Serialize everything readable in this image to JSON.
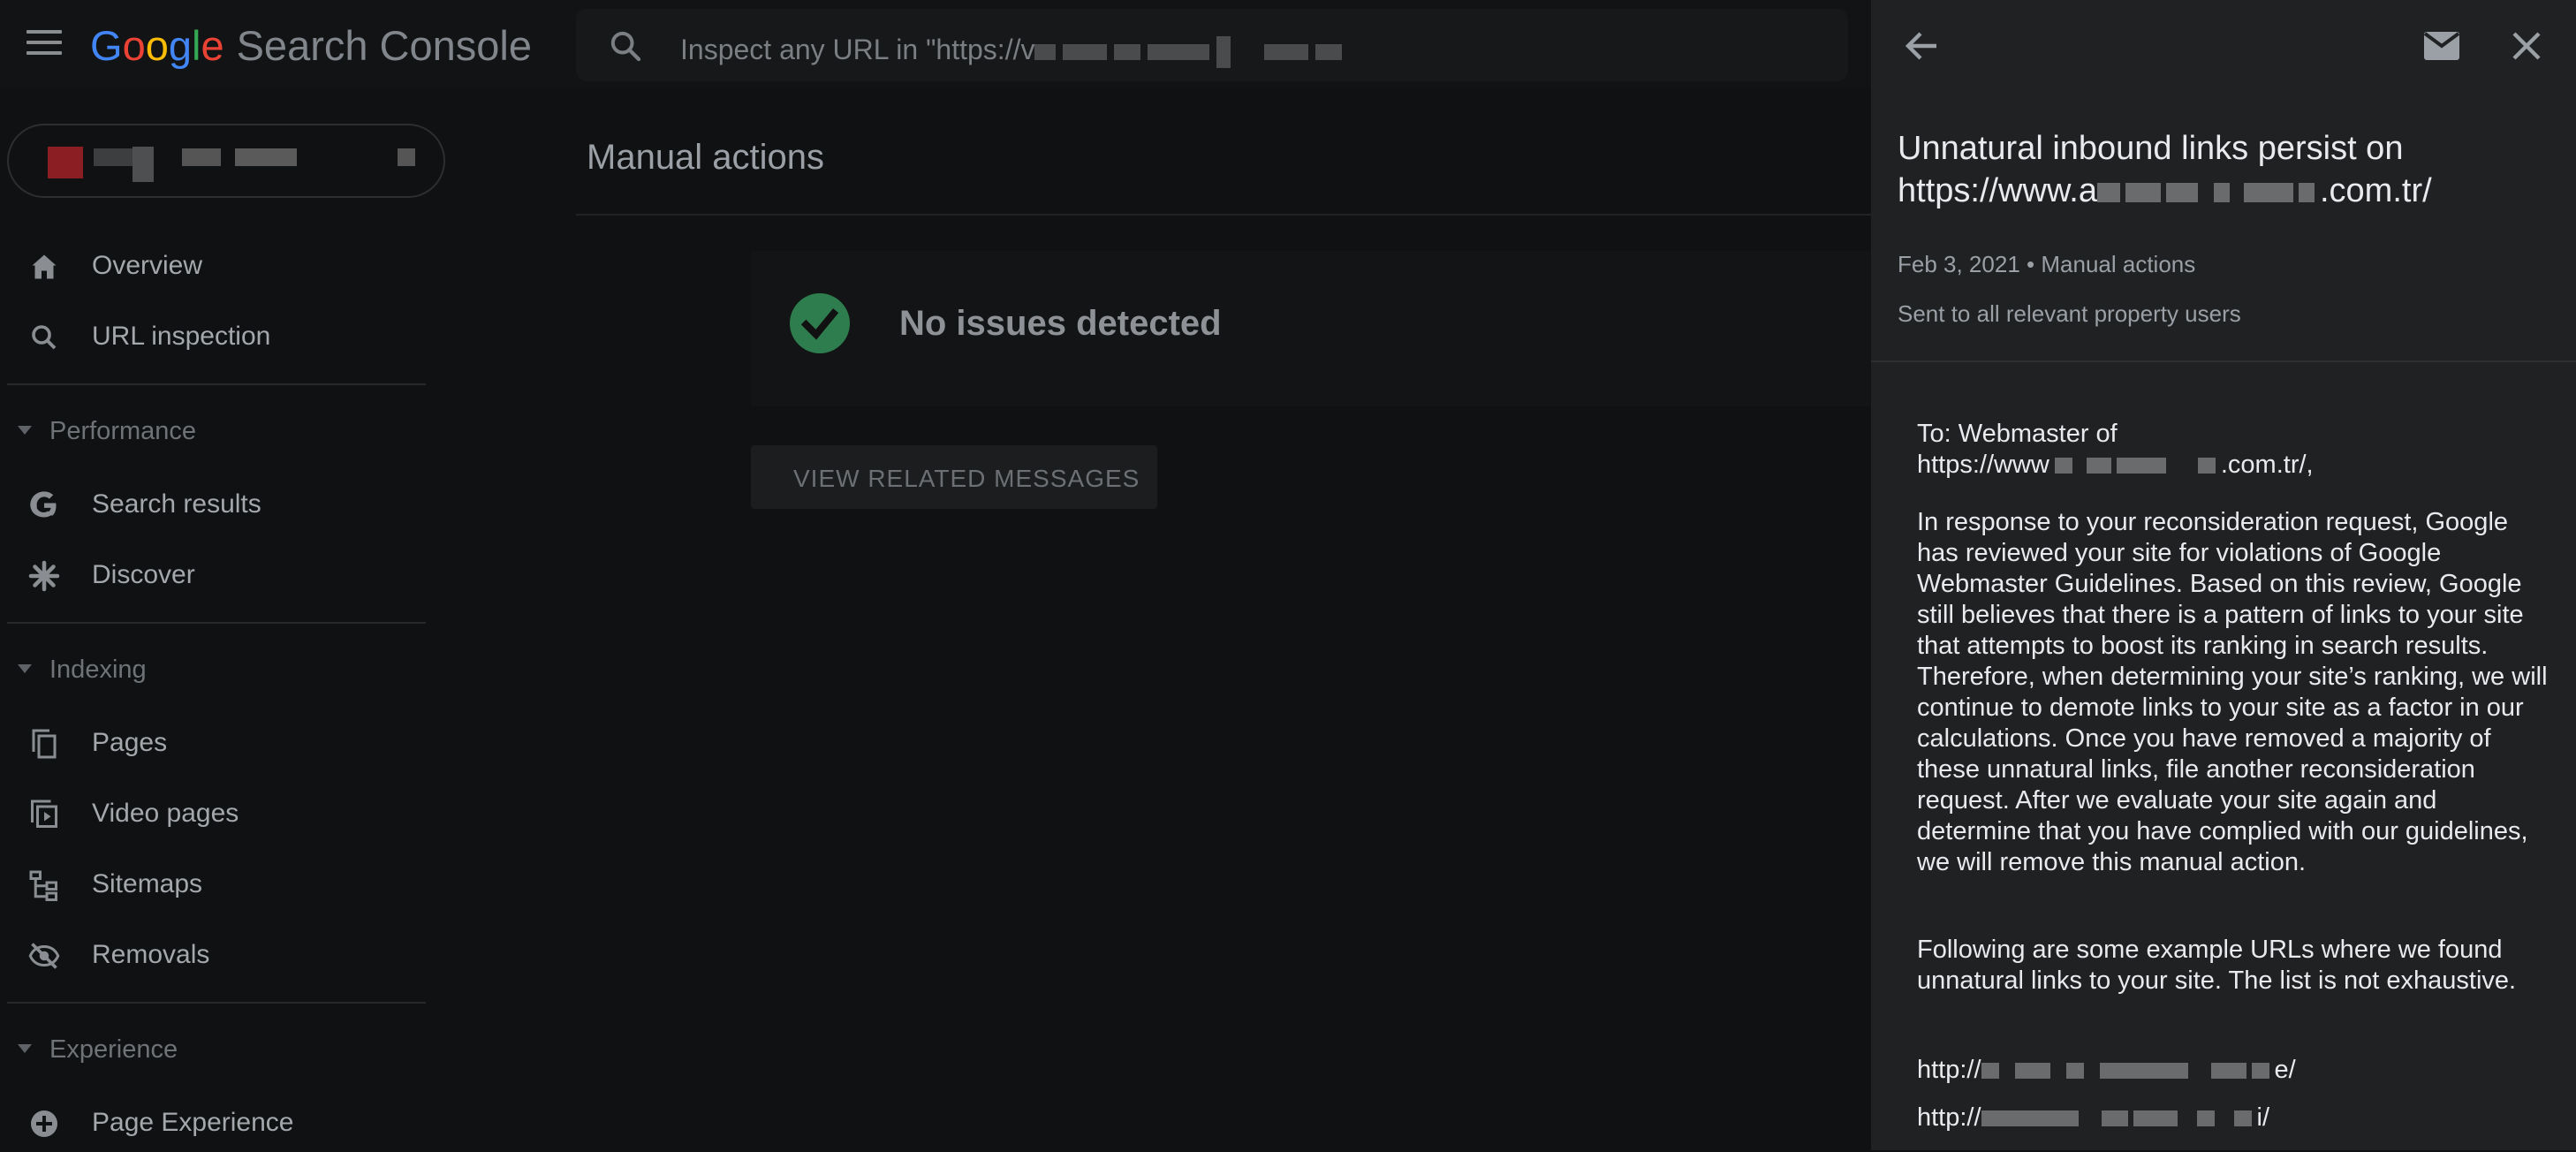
{
  "app": {
    "logo_letters": [
      "G",
      "o",
      "o",
      "g",
      "l",
      "e"
    ],
    "product_name": "Search Console"
  },
  "search": {
    "placeholder": "Inspect any URL in \"https://v"
  },
  "sidebar": {
    "items_top": [
      {
        "label": "Overview",
        "icon": "home-icon"
      },
      {
        "label": "URL inspection",
        "icon": "search-icon"
      }
    ],
    "sections": [
      {
        "title": "Performance",
        "items": [
          {
            "label": "Search results",
            "icon": "google-g-icon"
          },
          {
            "label": "Discover",
            "icon": "discover-asterisk-icon"
          }
        ]
      },
      {
        "title": "Indexing",
        "items": [
          {
            "label": "Pages",
            "icon": "pages-icon"
          },
          {
            "label": "Video pages",
            "icon": "video-pages-icon"
          },
          {
            "label": "Sitemaps",
            "icon": "sitemaps-icon"
          },
          {
            "label": "Removals",
            "icon": "removals-eye-off-icon"
          }
        ]
      },
      {
        "title": "Experience",
        "items": [
          {
            "label": "Page Experience",
            "icon": "page-experience-icon"
          }
        ]
      }
    ]
  },
  "main": {
    "title": "Manual actions",
    "status_text": "No issues detected",
    "view_button": "VIEW RELATED MESSAGES"
  },
  "panel": {
    "title_line1": "Unnatural inbound links persist on",
    "title_line2_prefix": "https://www.a",
    "title_line2_suffix": ".com.tr/",
    "date": "Feb 3, 2021",
    "separator": "•",
    "category": "Manual actions",
    "sent_to": "Sent to all relevant property users",
    "to_line": "To: Webmaster of",
    "to_url_prefix": "https://www",
    "to_url_suffix": ".com.tr/,",
    "paragraph1": "In response to your reconsideration request, Google has reviewed your site for violations of Google Webmaster Guidelines. Based on this review, Google still believes that there is a pattern of links to your site that attempts to boost its ranking in search results. Therefore, when determining your site’s ranking, we will continue to demote links to your site as a factor in our calculations. Once you have removed a majority of these unnatural links, file another reconsideration request. After we evaluate your site again and determine that you have complied with our guidelines, we will remove this manual action.",
    "paragraph2": "Following are some example URLs where we found unnatural links to your site. The list is not exhaustive.",
    "example_urls": [
      {
        "prefix": "http://",
        "suffix": "e/"
      },
      {
        "prefix": "http://",
        "suffix": "i/"
      }
    ]
  }
}
